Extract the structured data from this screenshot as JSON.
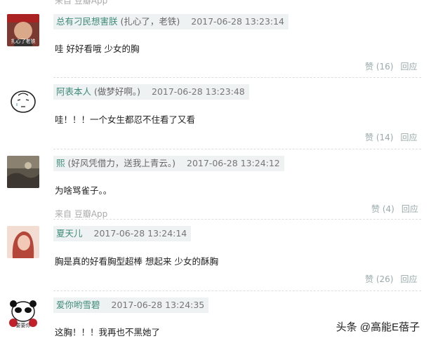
{
  "top_source": "来自 豆瓣App",
  "comments": [
    {
      "username": "总有刁民想害朕",
      "signature": "(扎心了，老铁)",
      "time": "2017-06-28 13:23:14",
      "avatar_caption": "扎心了老铁",
      "text": "哇 好好看哦 少女的胸",
      "like": "赞 (16)",
      "reply": "回应"
    },
    {
      "username": "阿表本人",
      "signature": "(做梦好啊。)",
      "time": "2017-06-28 13:23:48",
      "text": "哇！！！一个女生都忍不住看了又看",
      "like": "赞 (14)",
      "reply": "回应"
    },
    {
      "username": "熙",
      "signature": "(好风凭借力，送我上青云。)",
      "time": "2017-06-28 13:24:12",
      "text": "为啥骂雀子。。",
      "source": "来自 豆瓣App",
      "like": "赞 (4)",
      "reply": "回应"
    },
    {
      "username": "夏天儿",
      "signature": "",
      "time": "2017-06-28 13:24:14",
      "text": "胸是真的好看胸型超棒 想起来 少女的酥胸",
      "like": "赞 (26)",
      "reply": "回应"
    },
    {
      "username": "爱你哟雪碧",
      "signature": "",
      "time": "2017-06-28 13:24:35",
      "avatar_caption": "要要你",
      "text": "这胸！！！我再也不黑她了"
    }
  ],
  "watermark": "头条 @高能E蓓子",
  "colors": {
    "username": "#3d8a78",
    "meta_bg": "#eef2f2",
    "action": "#9aa"
  }
}
